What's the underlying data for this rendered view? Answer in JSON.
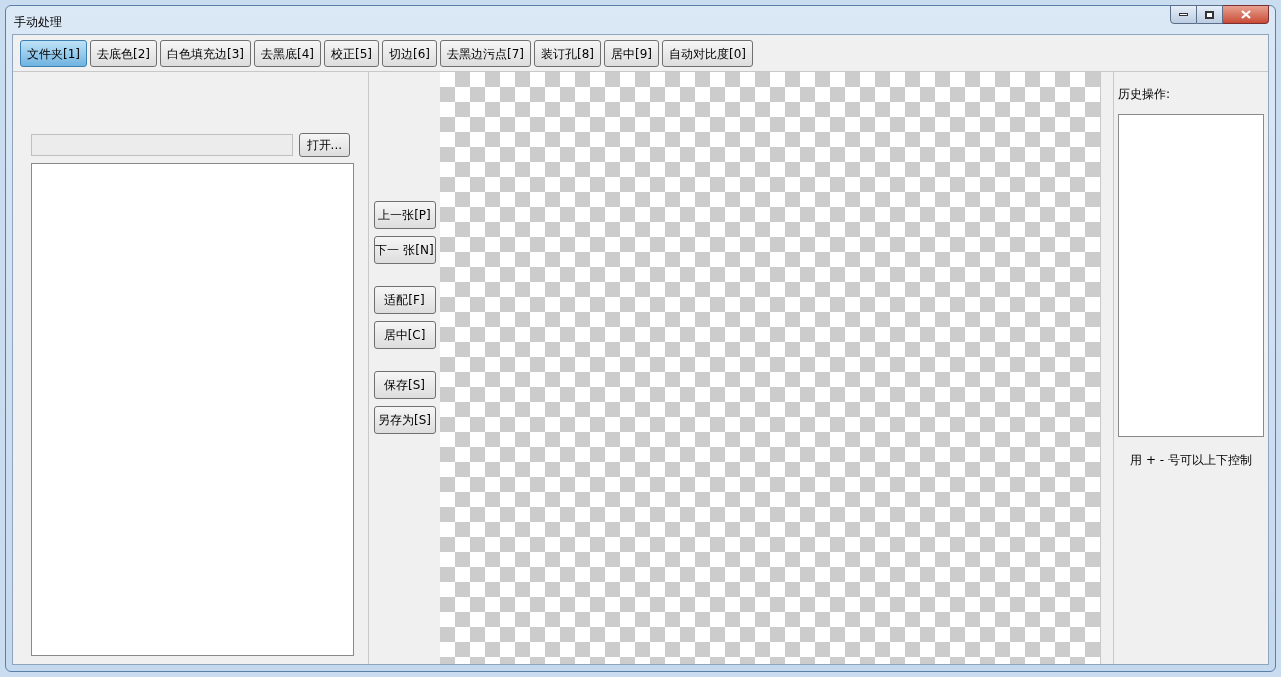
{
  "window": {
    "title": "手动处理"
  },
  "tabs": [
    {
      "label": "文件夹[1]",
      "selected": true
    },
    {
      "label": "去底色[2]",
      "selected": false
    },
    {
      "label": "白色填充边[3]",
      "selected": false
    },
    {
      "label": "去黑底[4]",
      "selected": false
    },
    {
      "label": "校正[5]",
      "selected": false
    },
    {
      "label": "切边[6]",
      "selected": false
    },
    {
      "label": "去黑边污点[7]",
      "selected": false
    },
    {
      "label": "装订孔[8]",
      "selected": false
    },
    {
      "label": "居中[9]",
      "selected": false
    },
    {
      "label": "自动对比度[0]",
      "selected": false
    }
  ],
  "file_panel": {
    "open_button": "打开..."
  },
  "nav_groups": [
    [
      "上一张[P]",
      "下一 张[N]"
    ],
    [
      "适配[F]",
      "居中[C]"
    ],
    [
      "保存[S]",
      "另存为[S]"
    ]
  ],
  "history": {
    "title": "历史操作:",
    "hint": "用 + - 号可以上下控制"
  }
}
